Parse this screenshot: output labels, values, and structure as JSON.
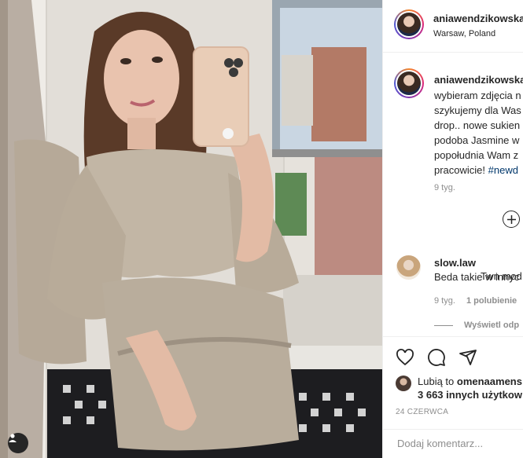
{
  "post": {
    "author": "aniawendzikowska",
    "location": "Warsaw, Poland"
  },
  "caption": {
    "username": "aniawendzikowska",
    "lines": [
      "wybieram zdjęcia n",
      "szykujemy dla Was",
      "drop.. nowe sukien",
      "podoba Jasmine w",
      "popołudnia Wam z",
      "pracowicie!"
    ],
    "hashtag": "#newd",
    "time": "9 tyg."
  },
  "comment": {
    "username": "slow.law",
    "text": "Twn mod",
    "line2": "Beda takie w innyc",
    "time": "9 tyg.",
    "likes": "1 polubienie",
    "view_replies": "Wyświetl odp"
  },
  "likes": {
    "prefix": "Lubią to",
    "first_user": "omenaamens",
    "others": "3 663 innych użytkow"
  },
  "date": "24 CZERWCA",
  "add_comment": {
    "placeholder": "Dodaj komentarz..."
  },
  "icons": {
    "like": "heart-icon",
    "comment": "comment-icon",
    "share": "paper-plane-icon",
    "load_more": "plus-circle-icon",
    "tag": "user-tag-icon"
  },
  "colors": {
    "hashtag": "#00376b",
    "muted": "#8e8e8e",
    "text": "#262626",
    "border": "#efefef"
  }
}
